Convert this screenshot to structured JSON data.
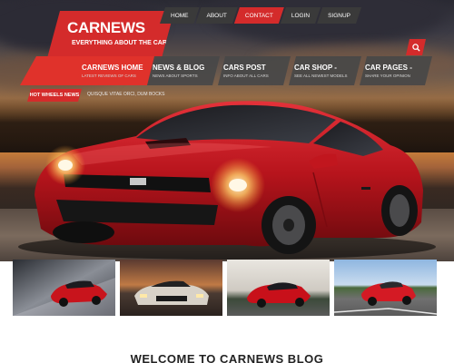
{
  "logo": {
    "name": "CARNEWS",
    "tagline": "EVERYTHING ABOUT THE CARS"
  },
  "top_nav": [
    {
      "label": "HOME",
      "active": false
    },
    {
      "label": "ABOUT",
      "active": false
    },
    {
      "label": "CONTACT",
      "active": true
    },
    {
      "label": "LOGIN",
      "active": false
    },
    {
      "label": "SIGNUP",
      "active": false
    }
  ],
  "main_nav": [
    {
      "title": "CARNEWS HOME",
      "subtitle": "LATEST REVIEWS OF CARS",
      "active": true
    },
    {
      "title": "NEWS & BLOG",
      "subtitle": "NEWS ABOUT SPORTS",
      "active": false
    },
    {
      "title": "CARS POST",
      "subtitle": "INFO ABOUT ALL CARS",
      "active": false
    },
    {
      "title": "CAR SHOP -",
      "subtitle": "SEE ALL NEWEST MODELS",
      "active": false
    },
    {
      "title": "CAR PAGES -",
      "subtitle": "SHARE YOUR OPINION",
      "active": false
    }
  ],
  "ticker": {
    "label": "HOT WHEELS NEWS",
    "text": "QUISQUE VITAE ORCI, DUM BOCKS"
  },
  "search": {
    "icon": "search-icon"
  },
  "thumbnails": [
    {
      "name": "thumb-red-sedan"
    },
    {
      "name": "thumb-muscle-car"
    },
    {
      "name": "thumb-red-coupe"
    },
    {
      "name": "thumb-red-roadster"
    }
  ],
  "welcome": {
    "title": "WELCOME TO CARNEWS BLOG"
  },
  "colors": {
    "accent": "#d42b2b",
    "nav_dark": "#3a3a3a"
  }
}
